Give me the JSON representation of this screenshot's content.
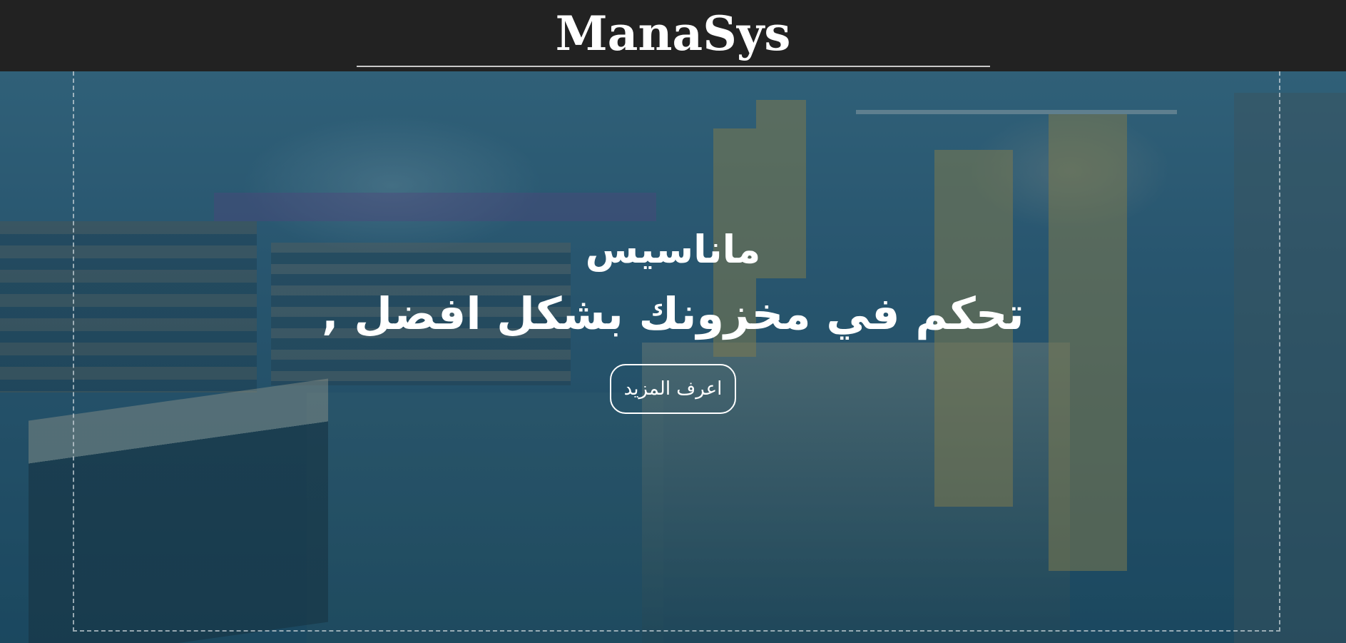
{
  "header": {
    "brand": "ManaSys"
  },
  "hero": {
    "title": "ماناسيس",
    "subtitle": "تحكم في مخزونك بشكل افضل ,",
    "cta_label": "اعرف المزيد"
  },
  "colors": {
    "topbar": "#222222",
    "overlay": "#2c566d",
    "text": "#ffffff"
  }
}
